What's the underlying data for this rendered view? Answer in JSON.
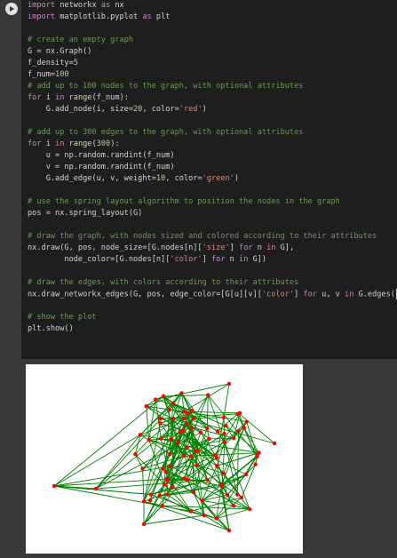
{
  "cell": {
    "run_icon": "play-icon",
    "code_lines": [
      "import networkx as nx",
      "import matplotlib.pyplot as plt",
      "",
      "# create an empty graph",
      "G = nx.Graph()",
      "f_density=5",
      "f_num=100",
      "# add up to 100 nodes to the graph, with optional attributes",
      "for i in range(f_num):",
      "    G.add_node(i, size=20, color='red')",
      "",
      "# add up to 300 edges to the graph, with optional attributes",
      "for i in range(300):",
      "    u = np.random.randint(f_num)",
      "    v = np.random.randint(f_num)",
      "    G.add_edge(u, v, weight=10, color='green')",
      "",
      "# use the spring layout algorithm to position the nodes in the graph",
      "pos = nx.spring_layout(G)",
      "",
      "# draw the graph, with nodes sized and colored according to their attributes",
      "nx.draw(G, pos, node_size=[G.nodes[n]['size'] for n in G],",
      "        node_color=[G.nodes[n]['color'] for n in G])",
      "",
      "# draw the edges, with colors according to their attributes",
      "nx.draw_networkx_edges(G, pos, edge_color=[G[u][v]['color'] for u, v in G.edges()])",
      "",
      "# show the plot",
      "plt.show()"
    ]
  },
  "output": {
    "plot": {
      "node_color": "#ff0000",
      "edge_color": "#008000",
      "background": "#ffffff"
    }
  }
}
